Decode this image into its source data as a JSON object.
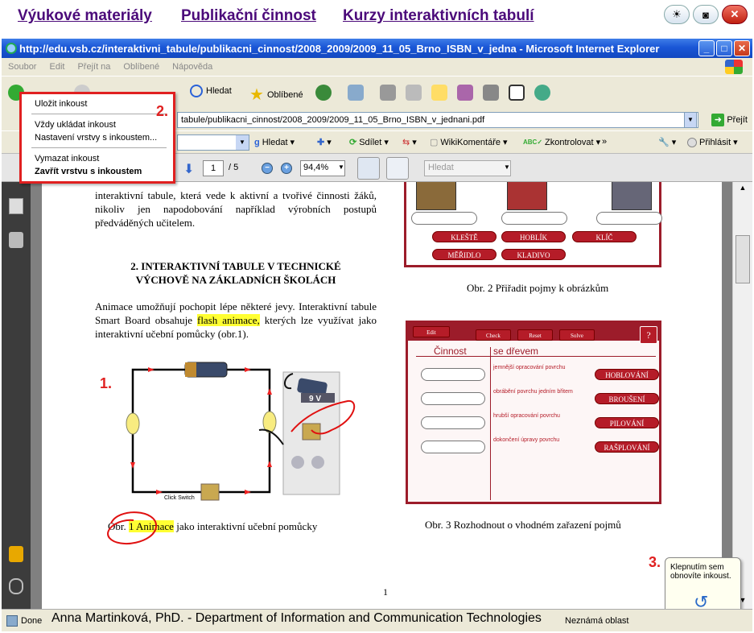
{
  "topnav": {
    "links": [
      "Výukové materiály",
      "Publikační činnost",
      "Kurzy interaktivních tabulí"
    ]
  },
  "window": {
    "title": "http://edu.vsb.cz/interaktivni_tabule/publikacni_cinnost/2008_2009/2009_11_05_Brno_ISBN_v_jedna - Microsoft Internet Explorer"
  },
  "menubar": [
    "Soubor",
    "Edit",
    "Přejít na",
    "Oblíbené",
    "Nápověda"
  ],
  "toolbar": {
    "search": "Hledat",
    "favorites": "Oblíbené"
  },
  "address": {
    "url_visible": "tabule/publikacni_cinnost/2008_2009/2009_11_05_Brno_ISBN_v_jednani.pdf",
    "go": "Přejít"
  },
  "googlebar": {
    "search": "Hledat",
    "share": "Sdílet",
    "wiki": "WikiKomentáře",
    "check": "Zkontrolovat",
    "more": "»",
    "signin": "Přihlásit"
  },
  "pdf": {
    "page": "1",
    "page_total": "/ 5",
    "zoom": "94,4%",
    "search_placeholder": "Hledat"
  },
  "popup": {
    "items": [
      "Uložit inkoust",
      "Vždy ukládat inkoust",
      "Nastavení vrstvy s inkoustem...",
      "Vymazat inkoust",
      "Zavřít vrstvu s inkoustem"
    ]
  },
  "annotations": {
    "one": "1.",
    "two": "2.",
    "three": "3."
  },
  "document": {
    "para1": "interaktivní tabule, která vede k aktivní a tvořivé činnosti žáků, nikoliv jen napodobování například výrobních postupů předváděných učitelem.",
    "heading_line1": "2.  INTERAKTIVNÍ TABULE V TECHNICKÉ",
    "heading_line2": "VÝCHOVĚ NA ZÁKLADNÍCH ŠKOLÁCH",
    "para2_a": "Animace umožňují pochopit lépe některé jevy. Interaktivní tabule Smart Board obsahuje ",
    "para2_hl": "flash animace,",
    "para2_b": " kterých lze využívat jako interaktivní učební pomůcky (obr.1).",
    "fig1_switch": "Click Switch",
    "fig1_battery": "9 V",
    "caption1_a": "Obr. ",
    "caption1_hl": "1 Animace",
    "caption1_b": " jako interaktivní učební pomůcky",
    "caption2": "Obr. 2 Přiřadit pojmy k obrázkům",
    "caption3": "Obr. 3 Rozhodnout o vhodném zařazení pojmů",
    "page_number": "1"
  },
  "fig2": {
    "pills_row1": [
      "KLEŠTĚ",
      "HOBLÍK",
      "KLÍČ"
    ],
    "pills_row2": [
      "MĚŘIDLO",
      "KLADIVO"
    ]
  },
  "fig3": {
    "buttons": [
      "Edit",
      "Check",
      "Reset",
      "Solve",
      "?"
    ],
    "col1": "Činnost",
    "col2": "se dřevem",
    "rows": [
      {
        "desc": "jemnější opracování povrchu",
        "answer": "HOBLOVÁNÍ"
      },
      {
        "desc": "obrábění povrchu jedním břitem",
        "answer": "BROUŠENÍ"
      },
      {
        "desc": "hrubší opracování povrchu",
        "answer": "PILOVÁNÍ"
      },
      {
        "desc": "dokončení úpravy povrchu",
        "answer": "RAŠPLOVÁNÍ"
      }
    ]
  },
  "tooltip": {
    "text": "Klepnutím sem obnovíte inkoust."
  },
  "status": {
    "done": "Done",
    "credit": "Anna Martinková, PhD. - Department of Information and Communication Technologies",
    "zone": "Neznámá oblast"
  }
}
